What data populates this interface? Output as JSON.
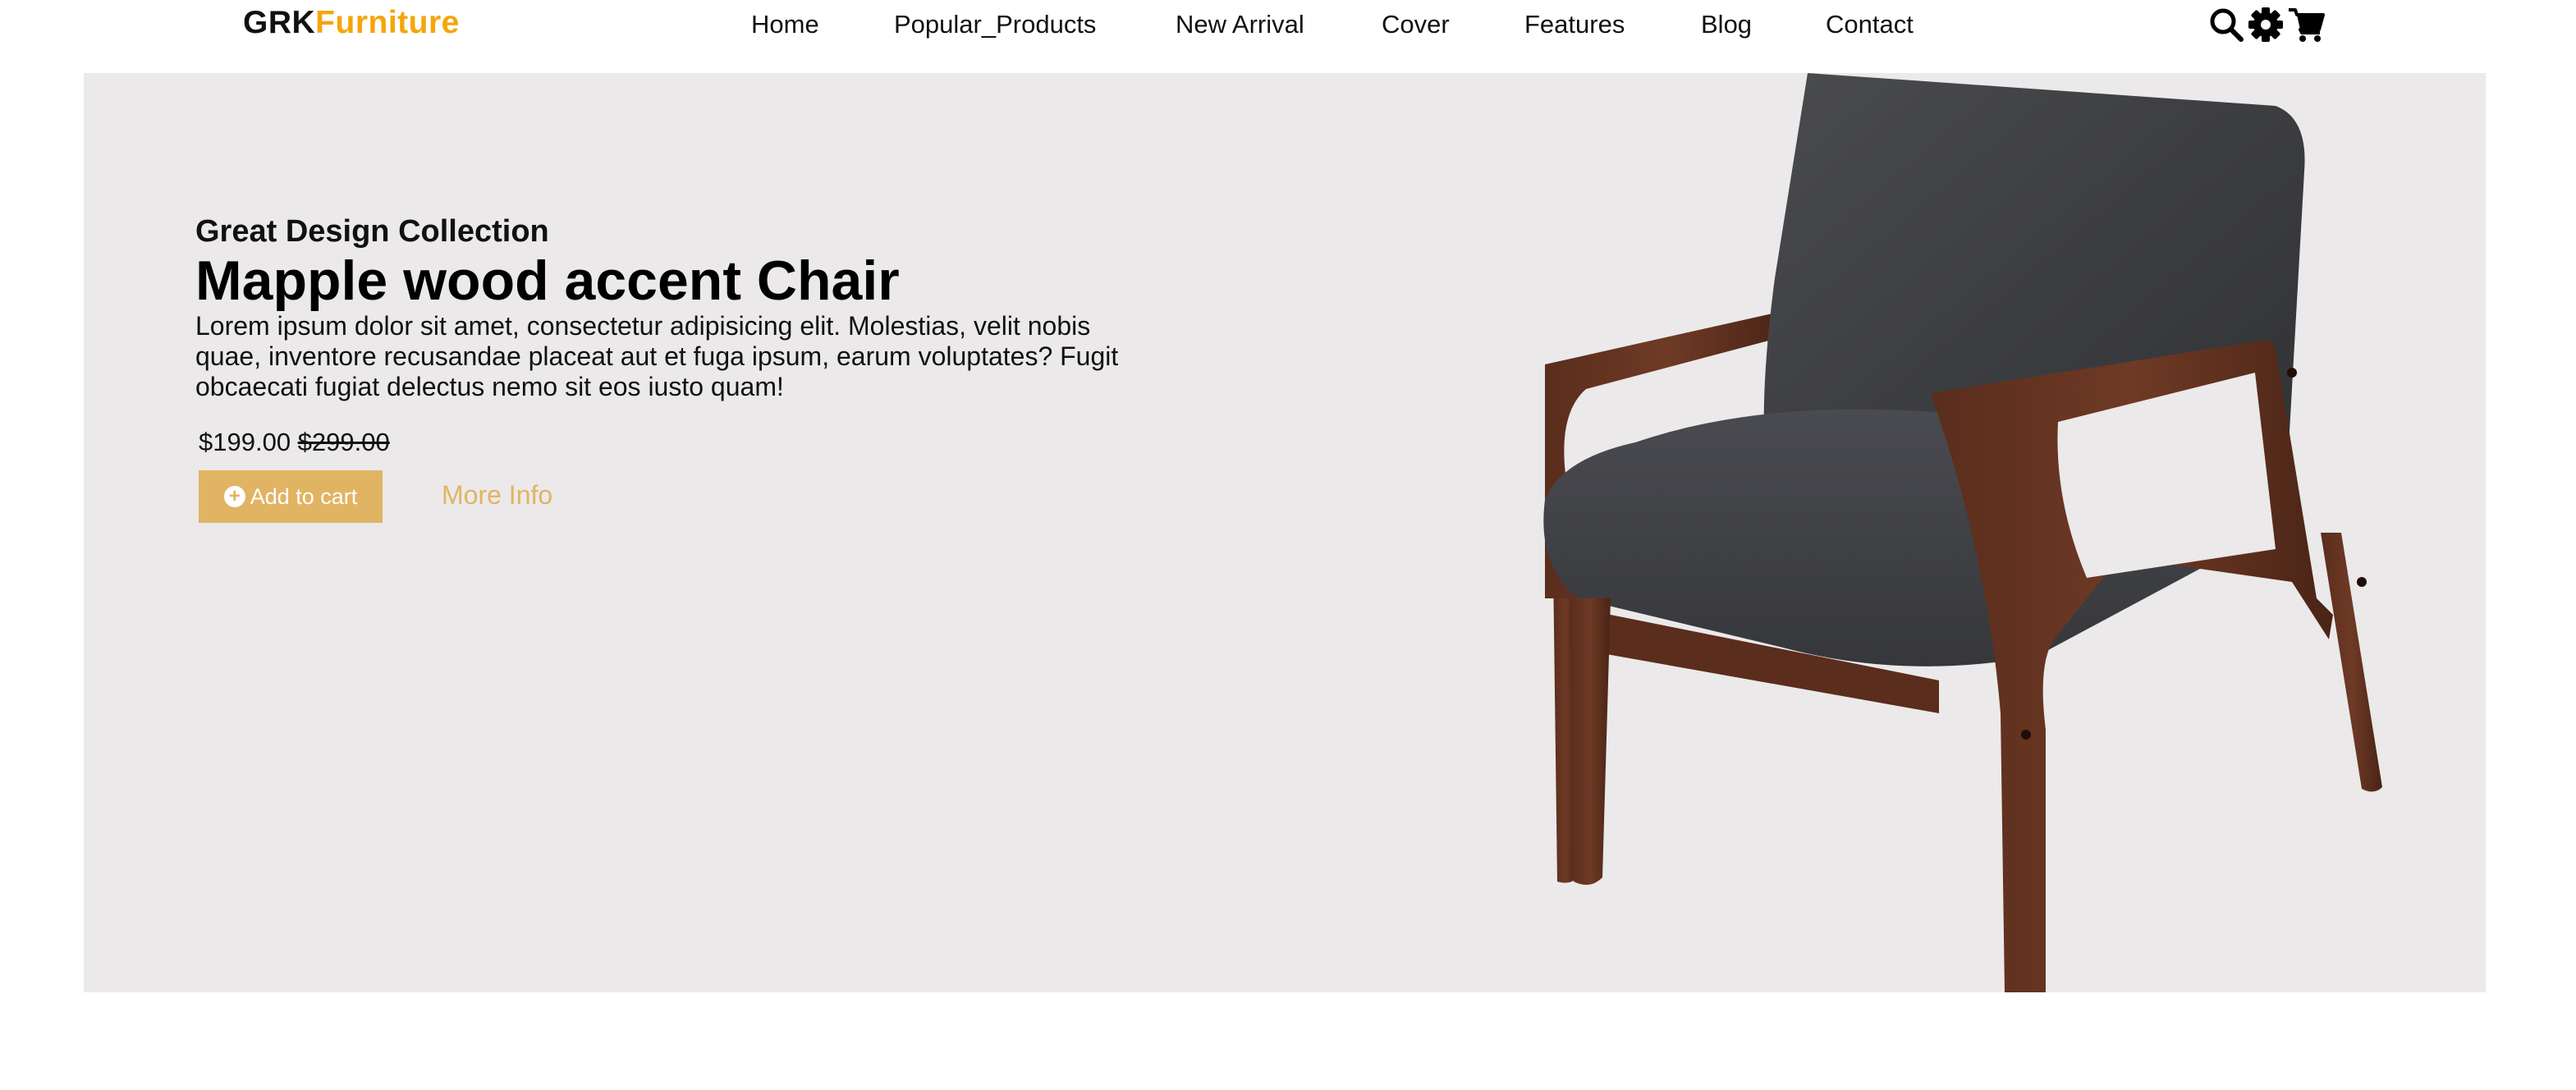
{
  "brand": {
    "part1": "GRK",
    "part2": "Furniture",
    "part2_color": "#f5a50a"
  },
  "nav": {
    "items": [
      {
        "label": "Home"
      },
      {
        "label": "Popular_Products"
      },
      {
        "label": "New Arrival"
      },
      {
        "label": "Cover"
      },
      {
        "label": "Features"
      },
      {
        "label": "Blog"
      },
      {
        "label": "Contact"
      }
    ]
  },
  "header_icons": [
    "search-icon",
    "gear-icon",
    "cart-icon"
  ],
  "hero": {
    "subtitle": "Great Design Collection",
    "title": "Mapple wood accent Chair",
    "description": "Lorem ipsum dolor sit amet, consectetur adipisicing elit. Molestias, velit nobis quae, inventore recusandae placeat aut et fuga ipsum, earum voluptates? Fugit obcaecati fugiat delectus nemo sit eos iusto quam!",
    "price": "$199.00",
    "old_price": "$299.00",
    "add_to_cart_label": "Add to cart",
    "more_info_label": "More Info",
    "accent_color": "#e1b463",
    "background_color": "#ebe9ea"
  }
}
